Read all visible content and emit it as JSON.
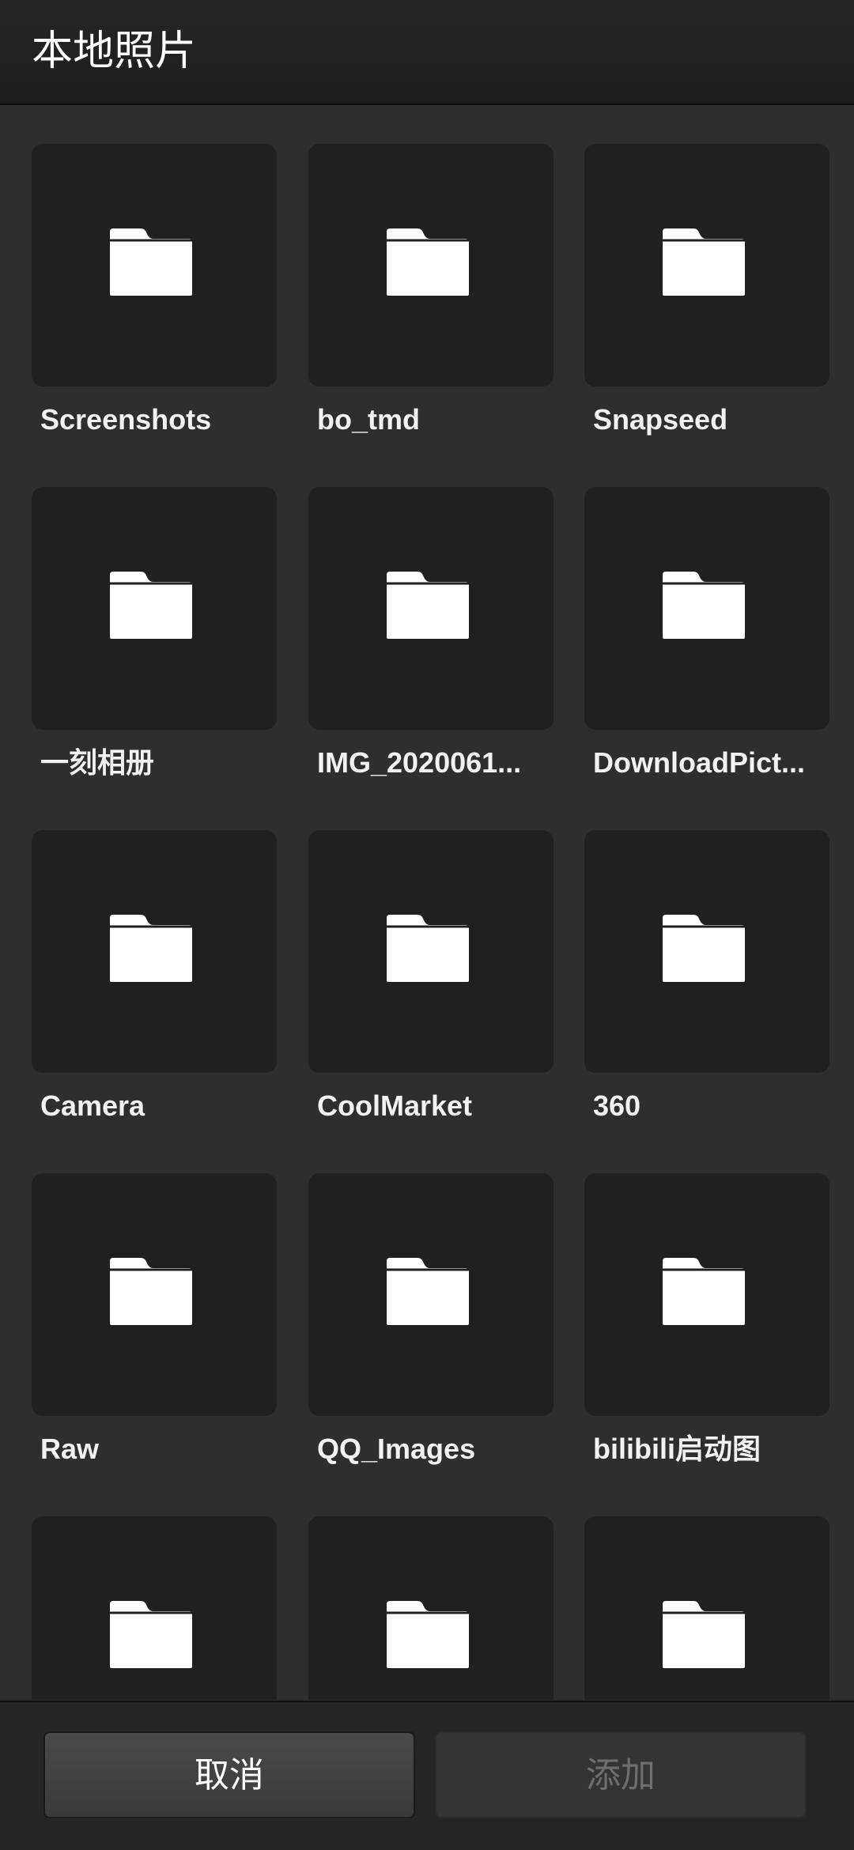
{
  "header": {
    "title": "本地照片"
  },
  "folders": [
    {
      "name": "Screenshots",
      "icon": "folder-icon"
    },
    {
      "name": "bo_tmd",
      "icon": "folder-icon"
    },
    {
      "name": "Snapseed",
      "icon": "folder-icon"
    },
    {
      "name": "一刻相册",
      "icon": "folder-icon"
    },
    {
      "name": "IMG_2020061...",
      "icon": "folder-icon"
    },
    {
      "name": "DownloadPict...",
      "icon": "folder-icon"
    },
    {
      "name": "Camera",
      "icon": "folder-icon"
    },
    {
      "name": "CoolMarket",
      "icon": "folder-icon"
    },
    {
      "name": "360",
      "icon": "folder-icon"
    },
    {
      "name": "Raw",
      "icon": "folder-icon"
    },
    {
      "name": "QQ_Images",
      "icon": "folder-icon"
    },
    {
      "name": "bilibili启动图",
      "icon": "folder-icon"
    },
    {
      "name": "",
      "icon": "folder-icon"
    },
    {
      "name": "",
      "icon": "folder-icon"
    },
    {
      "name": "",
      "icon": "folder-icon"
    }
  ],
  "footer": {
    "cancel_label": "取消",
    "add_label": "添加"
  }
}
